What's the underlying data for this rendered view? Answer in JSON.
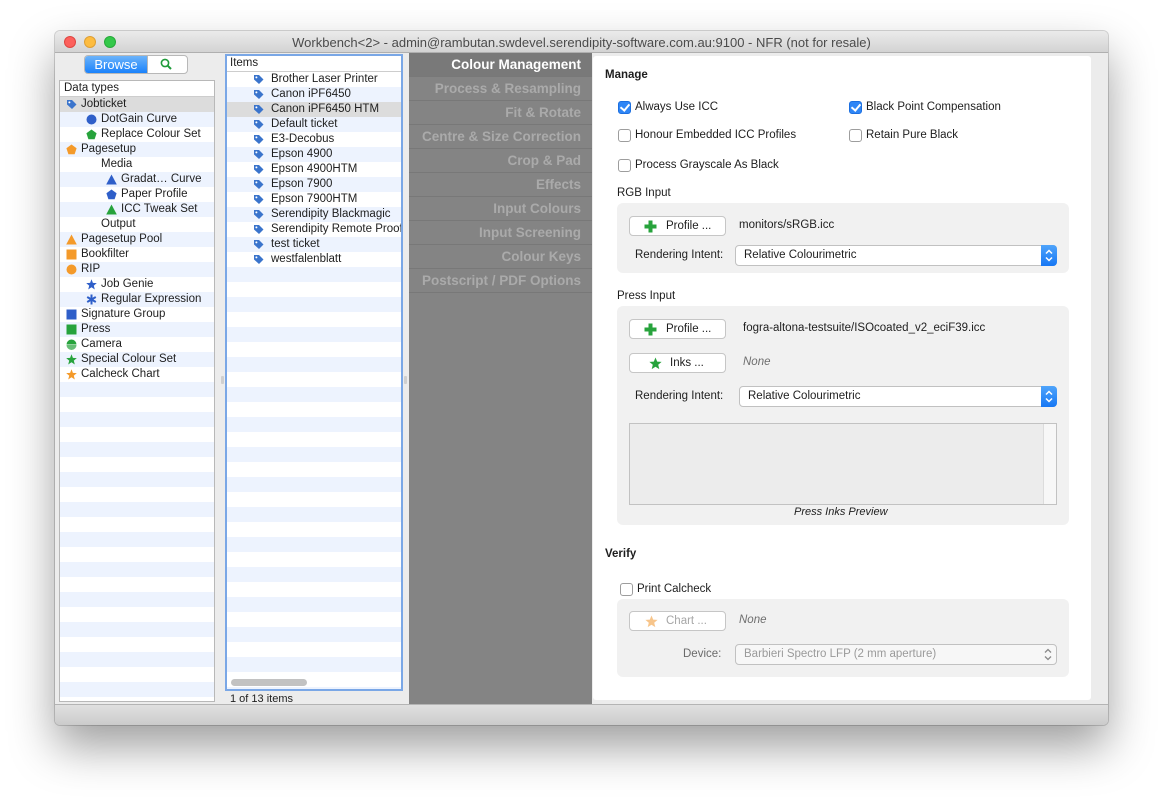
{
  "window": {
    "title": "Workbench<2> - admin@rambutan.swdevel.serendipity-software.com.au:9100 - NFR (not for resale)"
  },
  "sidebar": {
    "browse_label": "Browse",
    "header": "Data types",
    "types": [
      {
        "label": "Jobticket",
        "icon": "tag-icon",
        "color": "#3a74cc",
        "selected": true
      },
      {
        "label": "DotGain Curve",
        "icon": "circle-icon",
        "color": "#2f5fc9"
      },
      {
        "label": "Replace Colour Set",
        "icon": "pentagon-icon",
        "color": "#27a33c"
      },
      {
        "label": "Pagesetup",
        "icon": "pentagon-icon",
        "color": "#f49a2a"
      },
      {
        "label": "Media",
        "icon": "crescent-icon",
        "color": "#27a33c"
      },
      {
        "label": "Gradat… Curve",
        "icon": "triangle-icon",
        "color": "#2f5fc9"
      },
      {
        "label": "Paper Profile",
        "icon": "pentagon-icon",
        "color": "#2f5fc9"
      },
      {
        "label": "ICC Tweak Set",
        "icon": "triangle-icon",
        "color": "#27a33c"
      },
      {
        "label": "Output",
        "icon": "crescent-icon",
        "color": "#f49a2a"
      },
      {
        "label": "Pagesetup Pool",
        "icon": "triangle-icon",
        "color": "#f49a2a"
      },
      {
        "label": "Bookfilter",
        "icon": "square-icon",
        "color": "#f49a2a"
      },
      {
        "label": "RIP",
        "icon": "circle-icon",
        "color": "#f49a2a"
      },
      {
        "label": "Job Genie",
        "icon": "star-icon",
        "color": "#2f5fc9"
      },
      {
        "label": "Regular Expression",
        "icon": "asterisk-icon",
        "color": "#2f5fc9"
      },
      {
        "label": "Signature Group",
        "icon": "square-icon",
        "color": "#2f5fc9"
      },
      {
        "label": "Press",
        "icon": "square-icon",
        "color": "#27a33c"
      },
      {
        "label": "Camera",
        "icon": "half-circle-icon",
        "color": "#27a33c"
      },
      {
        "label": "Special Colour Set",
        "icon": "star-icon",
        "color": "#27a33c"
      },
      {
        "label": "Calcheck Chart",
        "icon": "star-icon",
        "color": "#f49a2a"
      }
    ]
  },
  "items": {
    "header": "Items",
    "rows": [
      {
        "label": "Brother Laser Printer"
      },
      {
        "label": "Canon iPF6450"
      },
      {
        "label": "Canon iPF6450 HTM",
        "selected": true
      },
      {
        "label": "Default ticket"
      },
      {
        "label": "E3-Decobus"
      },
      {
        "label": "Epson 4900"
      },
      {
        "label": "Epson 4900HTM"
      },
      {
        "label": "Epson 7900"
      },
      {
        "label": "Epson 7900HTM"
      },
      {
        "label": "Serendipity Blackmagic"
      },
      {
        "label": "Serendipity Remote Proof"
      },
      {
        "label": "test ticket"
      },
      {
        "label": "westfalenblatt"
      }
    ],
    "status": "1 of 13 items"
  },
  "tabs": [
    {
      "label": "Colour Management",
      "active": true
    },
    {
      "label": "Process & Resampling"
    },
    {
      "label": "Fit & Rotate"
    },
    {
      "label": "Centre & Size Correction"
    },
    {
      "label": "Crop & Pad"
    },
    {
      "label": "Effects"
    },
    {
      "label": "Input Colours"
    },
    {
      "label": "Input Screening"
    },
    {
      "label": "Colour Keys"
    },
    {
      "label": "Postscript / PDF Options"
    }
  ],
  "manage": {
    "title": "Manage",
    "always_use_icc": {
      "label": "Always Use ICC",
      "checked": true
    },
    "black_point": {
      "label": "Black Point Compensation",
      "checked": true
    },
    "honour_embedded": {
      "label": "Honour Embedded ICC Profiles",
      "checked": false
    },
    "retain_black": {
      "label": "Retain Pure Black",
      "checked": false
    },
    "process_grayscale": {
      "label": "Process Grayscale As Black",
      "checked": false
    }
  },
  "rgb_input": {
    "title": "RGB Input",
    "profile_button": "Profile ...",
    "profile_value": "monitors/sRGB.icc",
    "rendering_label": "Rendering Intent:",
    "rendering_value": "Relative Colourimetric"
  },
  "press_input": {
    "title": "Press Input",
    "profile_button": "Profile ...",
    "profile_value": "fogra-altona-testsuite/ISOcoated_v2_eciF39.icc",
    "inks_button": "Inks ...",
    "inks_value": "None",
    "rendering_label": "Rendering Intent:",
    "rendering_value": "Relative Colourimetric",
    "preview_caption": "Press Inks Preview"
  },
  "verify": {
    "title": "Verify",
    "print_calcheck": {
      "label": "Print Calcheck",
      "checked": false
    },
    "chart_button": "Chart ...",
    "chart_value": "None",
    "device_label": "Device:",
    "device_value": "Barbieri Spectro LFP (2 mm aperture)"
  },
  "colors": {
    "accent": "#1a82fb",
    "plus_green": "#27a33c",
    "tag_blue": "#3a74cc",
    "tab_background": "#848484"
  }
}
